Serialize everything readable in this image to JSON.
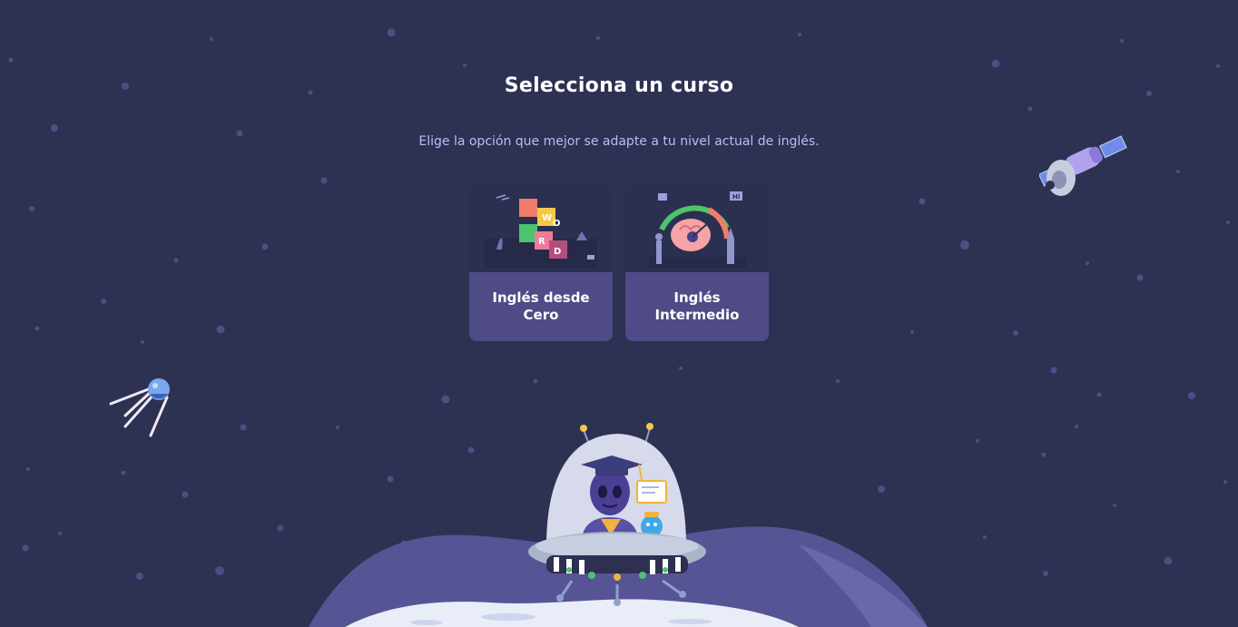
{
  "header": {
    "title": "Selecciona un curso",
    "subtitle": "Elige la opción que mejor se adapte a tu nivel actual de inglés."
  },
  "courses": [
    {
      "label": "Inglés desde\nCero",
      "icon": "word-blocks-illustration",
      "cube_letters": [
        "W",
        "O",
        "R",
        "D"
      ]
    },
    {
      "label": "Inglés\nIntermedio",
      "icon": "brain-gauge-illustration",
      "badge": "Hi"
    }
  ],
  "colors": {
    "background": "#2d3152",
    "card": "#4e4b86",
    "subtitle": "#b8bff5",
    "mountain": "#565495"
  }
}
